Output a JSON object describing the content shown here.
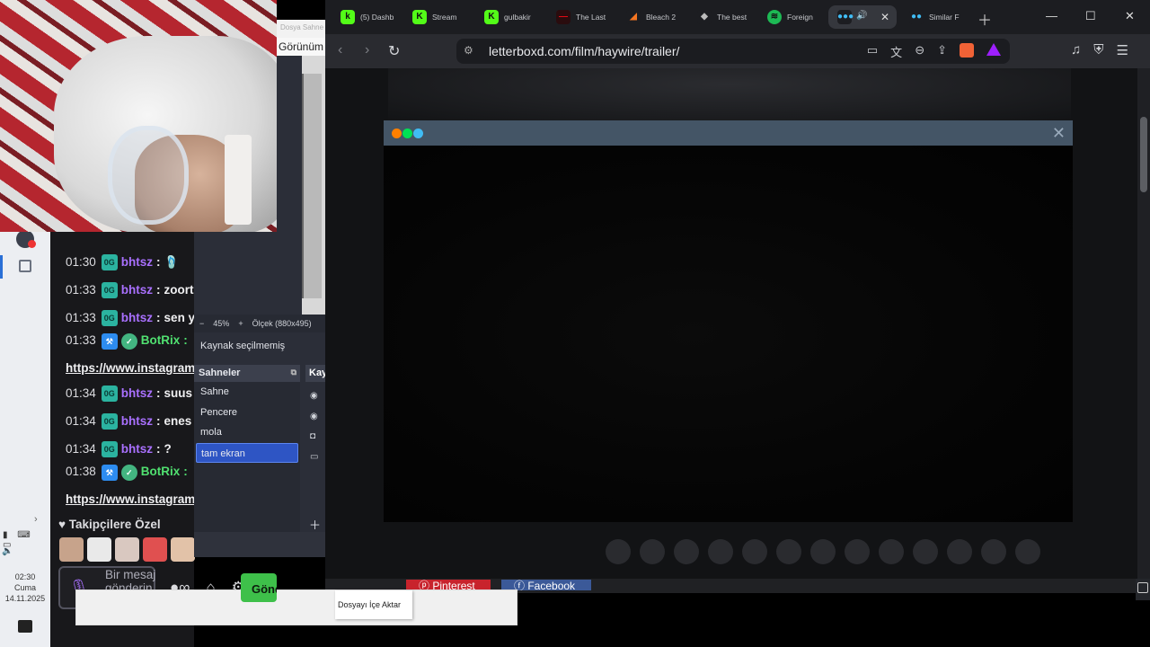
{
  "taskbar": {
    "time": "02:30",
    "day": "Cuma",
    "date": "14.11.2025"
  },
  "chat": {
    "lines": [
      {
        "time": "01:30",
        "user": "bhtsz",
        "msg": "🩴"
      },
      {
        "time": "01:33",
        "user": "bhtsz",
        "msg": "zoort"
      },
      {
        "time": "01:33",
        "user": "bhtsz",
        "msg": "sen ya"
      },
      {
        "time": "01:33",
        "user": "BotRix",
        "msg": "https://www.instagram"
      },
      {
        "time": "01:34",
        "user": "bhtsz",
        "msg": "suus"
      },
      {
        "time": "01:34",
        "user": "bhtsz",
        "msg": "enes u"
      },
      {
        "time": "01:34",
        "user": "bhtsz",
        "msg": "?"
      },
      {
        "time": "01:38",
        "user": "BotRix",
        "msg": "https://www.instagram"
      }
    ],
    "followers_label": "Takipçilere Özel",
    "composer_placeholder": "Bir mesaj gönderin",
    "send_label": "Gönder"
  },
  "obs": {
    "menu_item": "Görünüm",
    "top_hint": "Dosya Sahne",
    "zoom": "45%",
    "scale": "Ölçek (880x495)",
    "source_status": "Kaynak seçilmemiş",
    "scenes_title": "Sahneler",
    "sources_title": "Kaynaklar",
    "scenes": [
      "Sahne",
      "Pencere",
      "mola",
      "tam ekran"
    ],
    "active_scene": "tam ekran",
    "import_menu": "Dosyayı İçe Aktar"
  },
  "browser": {
    "tabs": [
      {
        "label": "(5) Dashb",
        "icon": "kick-icon",
        "color": "#53fc18"
      },
      {
        "label": "Stream",
        "icon": "k-icon",
        "color": "#53fc18"
      },
      {
        "label": "gulbakir",
        "icon": "k-icon",
        "color": "#53fc18"
      },
      {
        "label": "The Last",
        "icon": "netflix-icon",
        "color": "#e50914"
      },
      {
        "label": "Bleach 2",
        "icon": "crunchyroll-icon",
        "color": "#f47521"
      },
      {
        "label": "The best",
        "icon": "diamond-icon",
        "color": "#bbbbbb"
      },
      {
        "label": "Foreign",
        "icon": "spotify-icon",
        "color": "#1db954"
      },
      {
        "label": "",
        "icon": "letterboxd-icon",
        "color": "#40bcf4"
      },
      {
        "label": "Similar F",
        "icon": "letterboxd-icon",
        "color": "#40bcf4"
      }
    ],
    "url": "letterboxd.com/film/haywire/trailer/",
    "share_pinterest": "Pinterest",
    "share_facebook": "Facebook"
  },
  "colors": {
    "chat_bg": "#18181b",
    "username": "#a970ff",
    "bot_username": "#50e070",
    "obs_active": "#2e55c4",
    "modal_header": "#445566",
    "lbx_orange": "#ff8000",
    "lbx_green": "#00e054",
    "lbx_blue": "#40bcf4"
  }
}
